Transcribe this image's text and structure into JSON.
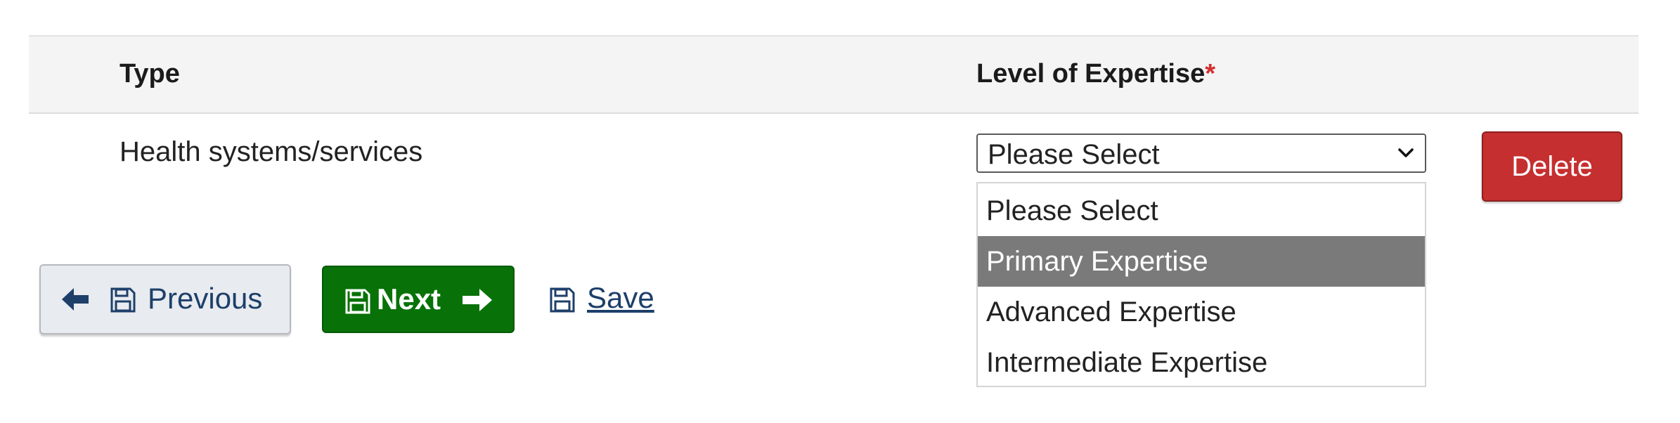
{
  "table": {
    "headers": {
      "type": "Type",
      "level": "Level of Expertise",
      "required_marker": "*"
    },
    "row": {
      "type_value": "Health systems/services"
    }
  },
  "level_select": {
    "selected": "Please Select",
    "options": [
      "Please Select",
      "Primary Expertise",
      "Advanced Expertise",
      "Intermediate Expertise"
    ],
    "highlighted_option": "Primary Expertise"
  },
  "actions": {
    "delete_label": "Delete",
    "previous_label": "Previous",
    "next_label": "Next",
    "save_label": "Save"
  },
  "icons": {
    "previous": [
      "arrow-left-icon",
      "floppy-disk-icon"
    ],
    "next": [
      "floppy-disk-icon",
      "arrow-right-icon"
    ],
    "save": [
      "floppy-disk-icon"
    ],
    "select": [
      "chevron-down-icon"
    ]
  },
  "colors": {
    "delete_bg": "#c62f2f",
    "next_bg": "#087208",
    "previous_bg": "#e8ebef",
    "link": "#1d3f6a",
    "required": "#d32f2f",
    "highlight": "#7a7a7a",
    "header_bg": "#f4f4f4"
  }
}
